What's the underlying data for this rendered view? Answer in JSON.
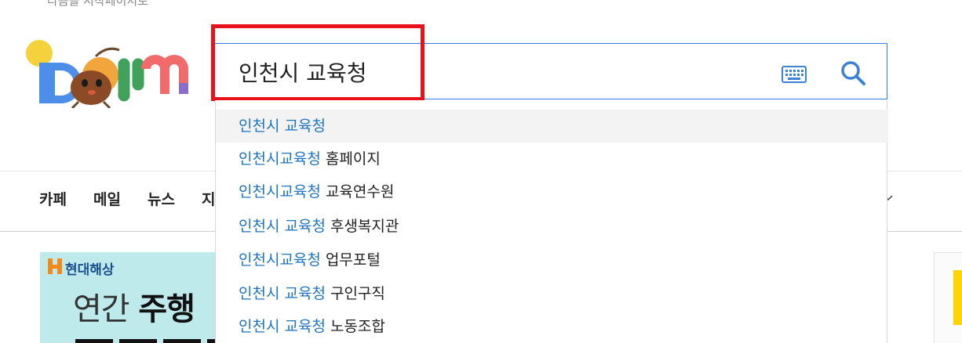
{
  "top_text": "다음을 시작페이지로",
  "logo": {
    "alt": "Daum"
  },
  "search": {
    "value": "인천시 교육청",
    "keyboard_icon": "keyboard-icon",
    "search_icon": "search-icon"
  },
  "colors": {
    "search_border": "#2e7bf0",
    "highlight_border": "#e8131a",
    "suggest_highlight": "#1d73c4",
    "ad_background": "#bfeaec"
  },
  "suggestions": [
    {
      "match": "인천시 교육청",
      "rest": ""
    },
    {
      "match": "인천시교육청",
      "rest": " 홈페이지"
    },
    {
      "match": "인천시교육청",
      "rest": " 교육연수원"
    },
    {
      "match": "인천시 교육청",
      "rest": " 후생복지관"
    },
    {
      "match": "인천시교육청",
      "rest": " 업무포털"
    },
    {
      "match": "인천시 교육청",
      "rest": " 구인구직"
    },
    {
      "match": "인천시 교육청",
      "rest": " 노동조합"
    }
  ],
  "nav": {
    "items": [
      "카페",
      "메일",
      "뉴스",
      "지"
    ],
    "more_icon": "chevron-down-icon"
  },
  "ad": {
    "brand": "현대해상",
    "text_light": "연간 ",
    "text_bold": "주행"
  }
}
